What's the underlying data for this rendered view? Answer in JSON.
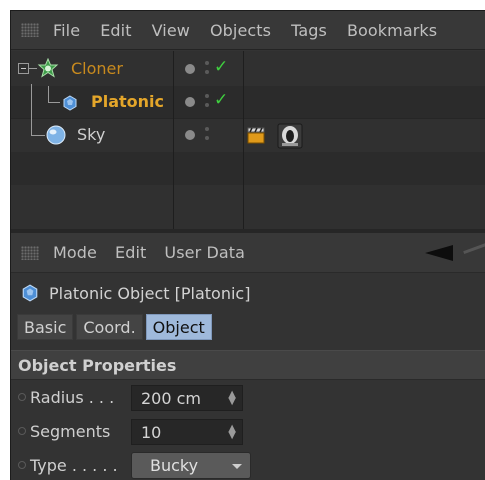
{
  "object_manager": {
    "menu": [
      "File",
      "Edit",
      "View",
      "Objects",
      "Tags",
      "Bookmarks"
    ],
    "objects": [
      {
        "name": "Cloner",
        "color": "#c88a1e",
        "checked": true
      },
      {
        "name": "Platonic",
        "color": "#e4a62a",
        "checked": true
      },
      {
        "name": "Sky",
        "color": "#cfcfcf",
        "checked": false
      }
    ]
  },
  "attribute_manager": {
    "menu": [
      "Mode",
      "Edit",
      "User Data"
    ],
    "title": "Platonic Object [Platonic]",
    "tabs": [
      {
        "label": "Basic",
        "active": false
      },
      {
        "label": "Coord.",
        "active": false
      },
      {
        "label": "Object",
        "active": true
      }
    ],
    "section": "Object Properties",
    "properties": {
      "radius": {
        "label": "Radius . . .",
        "value": "200 cm"
      },
      "segments": {
        "label": "Segments",
        "value": "10"
      },
      "type": {
        "label": "Type . . . . .",
        "value": "Bucky"
      }
    }
  },
  "colors": {
    "panel_bg": "#333333",
    "active_tab": "#9fb9db",
    "check_green": "#3fcf3f",
    "cloner_orange": "#c88a1e"
  },
  "icons": [
    "cloner-icon",
    "platonic-icon",
    "sky-icon",
    "check-icon",
    "clapper-tag-icon",
    "compositing-tag-icon",
    "back-arrow-icon"
  ]
}
